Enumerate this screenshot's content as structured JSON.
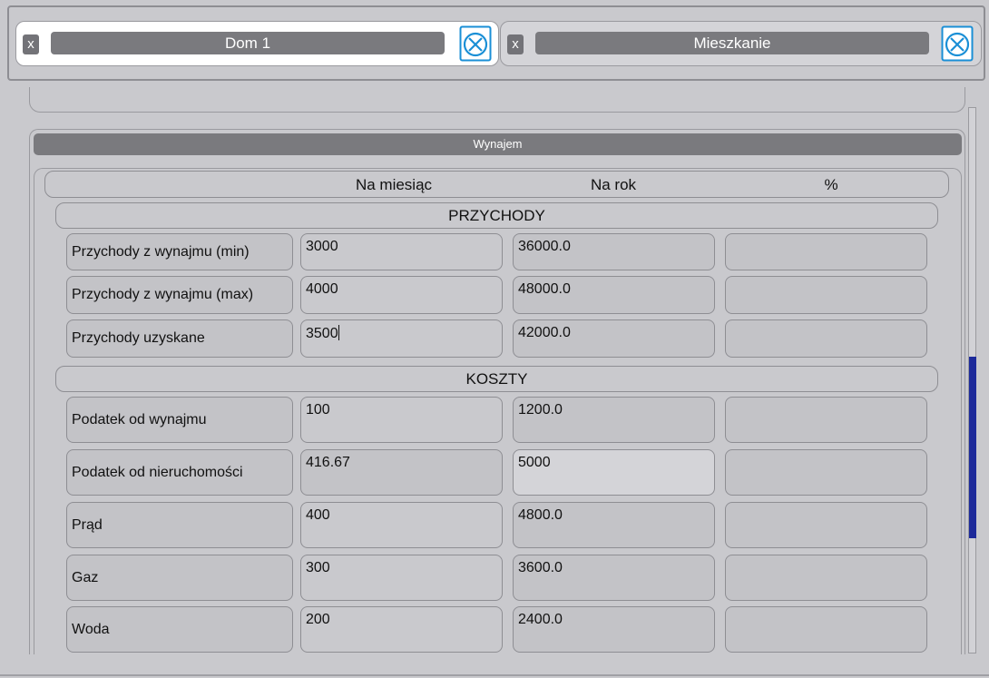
{
  "tabs": [
    {
      "close_label": "x",
      "label": "Dom 1",
      "icon": "circle-x-icon",
      "active": true
    },
    {
      "close_label": "x",
      "label": "Mieszkanie",
      "icon": "circle-x-icon",
      "active": false
    }
  ],
  "panel": {
    "title": "Wynajem"
  },
  "columns": {
    "monthly": "Na miesiąc",
    "yearly": "Na rok",
    "percent": "%"
  },
  "sections": {
    "revenue": "PRZYCHODY",
    "costs": "KOSZTY"
  },
  "revenue_rows": [
    {
      "label": "Przychody z wynajmu (min)",
      "monthly": "3000",
      "yearly": "36000.0",
      "percent": ""
    },
    {
      "label": "Przychody z wynajmu (max)",
      "monthly": "4000",
      "yearly": "48000.0",
      "percent": ""
    },
    {
      "label": "Przychody uzyskane",
      "monthly": "3500",
      "yearly": "42000.0",
      "percent": ""
    }
  ],
  "cost_rows": [
    {
      "label": "Podatek od wynajmu",
      "monthly": "100",
      "yearly": "1200.0",
      "percent": ""
    },
    {
      "label": "Podatek od nieruchomości",
      "monthly": "416.67",
      "yearly": "5000",
      "percent": ""
    },
    {
      "label": "Prąd",
      "monthly": "400",
      "yearly": "4800.0",
      "percent": ""
    },
    {
      "label": "Gaz",
      "monthly": "300",
      "yearly": "3600.0",
      "percent": ""
    },
    {
      "label": "Woda",
      "monthly": "200",
      "yearly": "2400.0",
      "percent": ""
    }
  ],
  "colors": {
    "accent": "#1d2a9a",
    "icon_blue": "#1a8fd6",
    "header_gray": "#7a7a7e"
  }
}
